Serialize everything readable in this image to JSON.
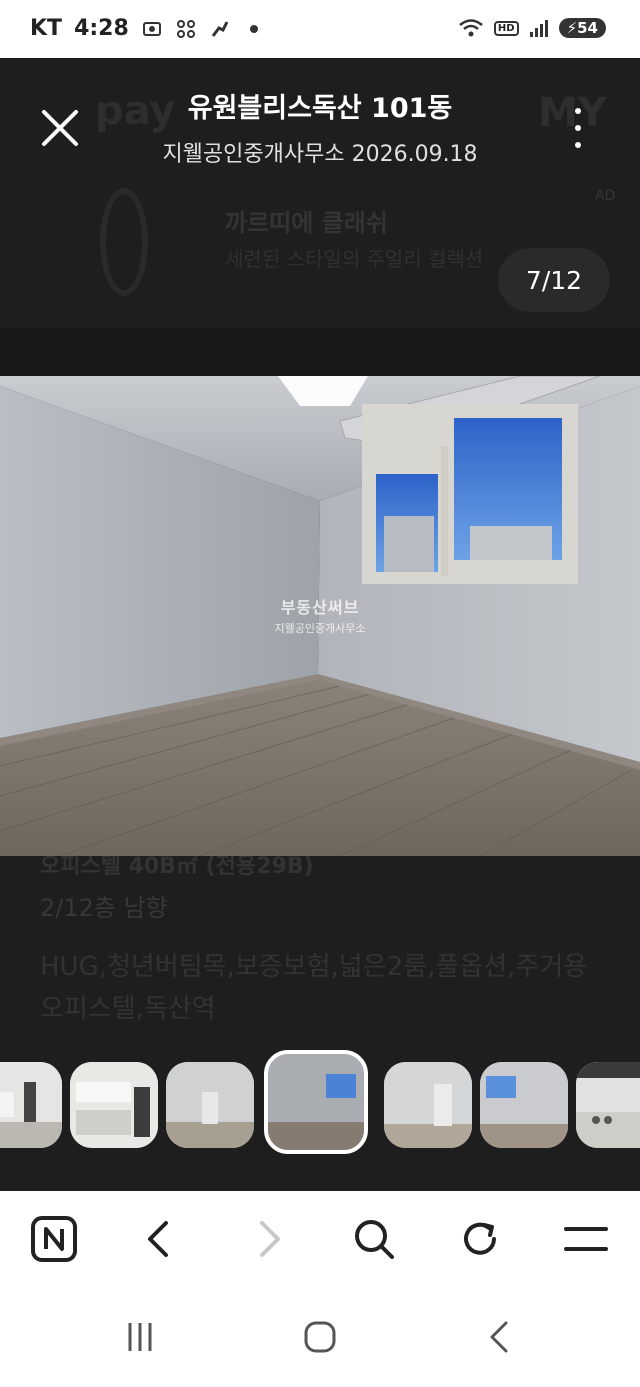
{
  "status_bar": {
    "carrier": "KT",
    "time": "4:28",
    "network_label": "HD",
    "battery": "54"
  },
  "background_page": {
    "pay_text": "pay",
    "my_text": "MY",
    "ad_label": "AD",
    "ad_title": "까르띠에 클래쉬",
    "ad_subtitle": "세련된 스타일의 주얼리 컬렉션",
    "listing_line1": "오피스텔 40B㎡ (전용29B)",
    "listing_line2": "2/12층   남향",
    "listing_tags": "HUG,청년버팀목,보증보험,넓은2룸,풀옵션,주거용오피스텔,독산역"
  },
  "viewer": {
    "title": "유원블리스독산 101동",
    "subtitle": "지웰공인중개사무소 2026.09.18",
    "counter": "7/12",
    "watermark_name": "부동산써브",
    "watermark_office": "지웰공인중개사무소"
  },
  "thumbnails": [
    "kitchen-1",
    "kitchen-2",
    "room-1",
    "room-current",
    "room-3",
    "room-4",
    "kitchen-3"
  ],
  "browser_bar": {
    "icons": [
      "naver-home-icon",
      "back-icon",
      "forward-icon",
      "search-icon",
      "refresh-icon",
      "menu-icon"
    ]
  },
  "colors": {
    "backdrop": "#1e1e1e",
    "overlay_text": "#ffffff",
    "bars": "#ffffff"
  }
}
